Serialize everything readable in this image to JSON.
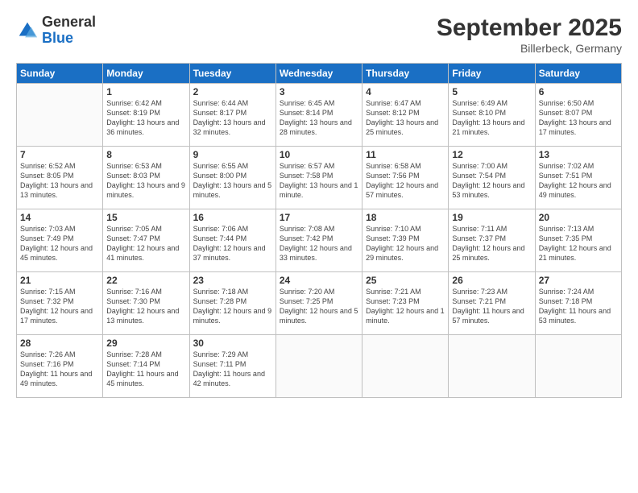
{
  "logo": {
    "general": "General",
    "blue": "Blue"
  },
  "header": {
    "month": "September 2025",
    "location": "Billerbeck, Germany"
  },
  "weekdays": [
    "Sunday",
    "Monday",
    "Tuesday",
    "Wednesday",
    "Thursday",
    "Friday",
    "Saturday"
  ],
  "weeks": [
    [
      {
        "day": "",
        "sunrise": "",
        "sunset": "",
        "daylight": ""
      },
      {
        "day": "1",
        "sunrise": "Sunrise: 6:42 AM",
        "sunset": "Sunset: 8:19 PM",
        "daylight": "Daylight: 13 hours and 36 minutes."
      },
      {
        "day": "2",
        "sunrise": "Sunrise: 6:44 AM",
        "sunset": "Sunset: 8:17 PM",
        "daylight": "Daylight: 13 hours and 32 minutes."
      },
      {
        "day": "3",
        "sunrise": "Sunrise: 6:45 AM",
        "sunset": "Sunset: 8:14 PM",
        "daylight": "Daylight: 13 hours and 28 minutes."
      },
      {
        "day": "4",
        "sunrise": "Sunrise: 6:47 AM",
        "sunset": "Sunset: 8:12 PM",
        "daylight": "Daylight: 13 hours and 25 minutes."
      },
      {
        "day": "5",
        "sunrise": "Sunrise: 6:49 AM",
        "sunset": "Sunset: 8:10 PM",
        "daylight": "Daylight: 13 hours and 21 minutes."
      },
      {
        "day": "6",
        "sunrise": "Sunrise: 6:50 AM",
        "sunset": "Sunset: 8:07 PM",
        "daylight": "Daylight: 13 hours and 17 minutes."
      }
    ],
    [
      {
        "day": "7",
        "sunrise": "Sunrise: 6:52 AM",
        "sunset": "Sunset: 8:05 PM",
        "daylight": "Daylight: 13 hours and 13 minutes."
      },
      {
        "day": "8",
        "sunrise": "Sunrise: 6:53 AM",
        "sunset": "Sunset: 8:03 PM",
        "daylight": "Daylight: 13 hours and 9 minutes."
      },
      {
        "day": "9",
        "sunrise": "Sunrise: 6:55 AM",
        "sunset": "Sunset: 8:00 PM",
        "daylight": "Daylight: 13 hours and 5 minutes."
      },
      {
        "day": "10",
        "sunrise": "Sunrise: 6:57 AM",
        "sunset": "Sunset: 7:58 PM",
        "daylight": "Daylight: 13 hours and 1 minute."
      },
      {
        "day": "11",
        "sunrise": "Sunrise: 6:58 AM",
        "sunset": "Sunset: 7:56 PM",
        "daylight": "Daylight: 12 hours and 57 minutes."
      },
      {
        "day": "12",
        "sunrise": "Sunrise: 7:00 AM",
        "sunset": "Sunset: 7:54 PM",
        "daylight": "Daylight: 12 hours and 53 minutes."
      },
      {
        "day": "13",
        "sunrise": "Sunrise: 7:02 AM",
        "sunset": "Sunset: 7:51 PM",
        "daylight": "Daylight: 12 hours and 49 minutes."
      }
    ],
    [
      {
        "day": "14",
        "sunrise": "Sunrise: 7:03 AM",
        "sunset": "Sunset: 7:49 PM",
        "daylight": "Daylight: 12 hours and 45 minutes."
      },
      {
        "day": "15",
        "sunrise": "Sunrise: 7:05 AM",
        "sunset": "Sunset: 7:47 PM",
        "daylight": "Daylight: 12 hours and 41 minutes."
      },
      {
        "day": "16",
        "sunrise": "Sunrise: 7:06 AM",
        "sunset": "Sunset: 7:44 PM",
        "daylight": "Daylight: 12 hours and 37 minutes."
      },
      {
        "day": "17",
        "sunrise": "Sunrise: 7:08 AM",
        "sunset": "Sunset: 7:42 PM",
        "daylight": "Daylight: 12 hours and 33 minutes."
      },
      {
        "day": "18",
        "sunrise": "Sunrise: 7:10 AM",
        "sunset": "Sunset: 7:39 PM",
        "daylight": "Daylight: 12 hours and 29 minutes."
      },
      {
        "day": "19",
        "sunrise": "Sunrise: 7:11 AM",
        "sunset": "Sunset: 7:37 PM",
        "daylight": "Daylight: 12 hours and 25 minutes."
      },
      {
        "day": "20",
        "sunrise": "Sunrise: 7:13 AM",
        "sunset": "Sunset: 7:35 PM",
        "daylight": "Daylight: 12 hours and 21 minutes."
      }
    ],
    [
      {
        "day": "21",
        "sunrise": "Sunrise: 7:15 AM",
        "sunset": "Sunset: 7:32 PM",
        "daylight": "Daylight: 12 hours and 17 minutes."
      },
      {
        "day": "22",
        "sunrise": "Sunrise: 7:16 AM",
        "sunset": "Sunset: 7:30 PM",
        "daylight": "Daylight: 12 hours and 13 minutes."
      },
      {
        "day": "23",
        "sunrise": "Sunrise: 7:18 AM",
        "sunset": "Sunset: 7:28 PM",
        "daylight": "Daylight: 12 hours and 9 minutes."
      },
      {
        "day": "24",
        "sunrise": "Sunrise: 7:20 AM",
        "sunset": "Sunset: 7:25 PM",
        "daylight": "Daylight: 12 hours and 5 minutes."
      },
      {
        "day": "25",
        "sunrise": "Sunrise: 7:21 AM",
        "sunset": "Sunset: 7:23 PM",
        "daylight": "Daylight: 12 hours and 1 minute."
      },
      {
        "day": "26",
        "sunrise": "Sunrise: 7:23 AM",
        "sunset": "Sunset: 7:21 PM",
        "daylight": "Daylight: 11 hours and 57 minutes."
      },
      {
        "day": "27",
        "sunrise": "Sunrise: 7:24 AM",
        "sunset": "Sunset: 7:18 PM",
        "daylight": "Daylight: 11 hours and 53 minutes."
      }
    ],
    [
      {
        "day": "28",
        "sunrise": "Sunrise: 7:26 AM",
        "sunset": "Sunset: 7:16 PM",
        "daylight": "Daylight: 11 hours and 49 minutes."
      },
      {
        "day": "29",
        "sunrise": "Sunrise: 7:28 AM",
        "sunset": "Sunset: 7:14 PM",
        "daylight": "Daylight: 11 hours and 45 minutes."
      },
      {
        "day": "30",
        "sunrise": "Sunrise: 7:29 AM",
        "sunset": "Sunset: 7:11 PM",
        "daylight": "Daylight: 11 hours and 42 minutes."
      },
      {
        "day": "",
        "sunrise": "",
        "sunset": "",
        "daylight": ""
      },
      {
        "day": "",
        "sunrise": "",
        "sunset": "",
        "daylight": ""
      },
      {
        "day": "",
        "sunrise": "",
        "sunset": "",
        "daylight": ""
      },
      {
        "day": "",
        "sunrise": "",
        "sunset": "",
        "daylight": ""
      }
    ]
  ]
}
